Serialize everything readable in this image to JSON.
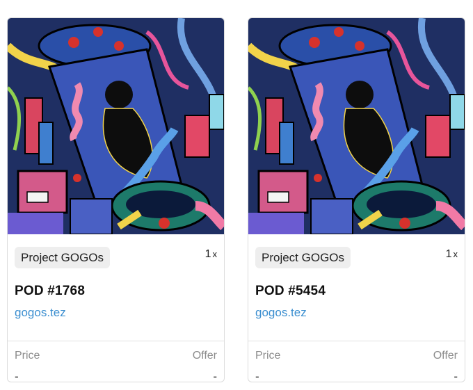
{
  "cards": [
    {
      "collection": "Project GOGOs",
      "quantity": "1",
      "quantity_suffix": "x",
      "title": "POD #1768",
      "owner": "gogos.tez",
      "price_label": "Price",
      "price_value": "-",
      "offer_label": "Offer",
      "offer_value": "-"
    },
    {
      "collection": "Project GOGOs",
      "quantity": "1",
      "quantity_suffix": "x",
      "title": "POD #5454",
      "owner": "gogos.tez",
      "price_label": "Price",
      "price_value": "-",
      "offer_label": "Offer",
      "offer_value": "-"
    }
  ],
  "colors": {
    "link": "#3c8fd0",
    "muted_text": "#8c8c8c",
    "tag_background": "#eeeeee",
    "art_background": "#1f2f63",
    "capsule_blue": "#3a56b8",
    "figure": "#0d0d0d"
  }
}
